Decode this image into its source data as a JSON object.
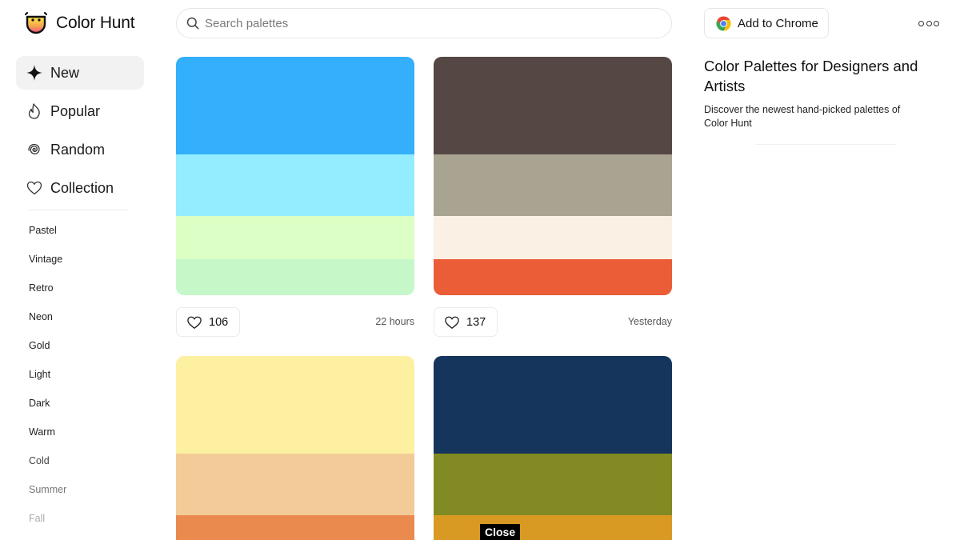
{
  "app": {
    "name": "Color Hunt"
  },
  "search": {
    "placeholder": "Search palettes",
    "value": ""
  },
  "header": {
    "extension_label": "Add to Chrome",
    "more_icon": "more-dots-icon"
  },
  "sidebar": {
    "nav": [
      {
        "label": "New",
        "icon": "sparkle-icon",
        "active": true
      },
      {
        "label": "Popular",
        "icon": "flame-icon",
        "active": false
      },
      {
        "label": "Random",
        "icon": "spiral-icon",
        "active": false
      },
      {
        "label": "Collection",
        "icon": "heart-icon",
        "active": false
      }
    ],
    "tags": [
      "Pastel",
      "Vintage",
      "Retro",
      "Neon",
      "Gold",
      "Light",
      "Dark",
      "Warm",
      "Cold",
      "Summer",
      "Fall"
    ]
  },
  "palettes": [
    {
      "colors": [
        "#33AFFC",
        "#94ECFF",
        "#DCFFC6",
        "#C5F7C9"
      ],
      "likes": "106",
      "time": "22 hours"
    },
    {
      "colors": [
        "#544744",
        "#A9A391",
        "#FAF0E4",
        "#EA5D37"
      ],
      "likes": "137",
      "time": "Yesterday"
    },
    {
      "colors": [
        "#FDF0A1",
        "#F2CB99",
        "#EB8A4E",
        "#EB8A4E"
      ]
    },
    {
      "colors": [
        "#15355C",
        "#828A23",
        "#D89A23",
        "#D89A23"
      ]
    }
  ],
  "intro": {
    "title": "Color Palettes for Designers and Artists",
    "description": "Discover the newest hand-picked palettes of Color Hunt"
  },
  "overlay": {
    "close_label": "Close"
  }
}
